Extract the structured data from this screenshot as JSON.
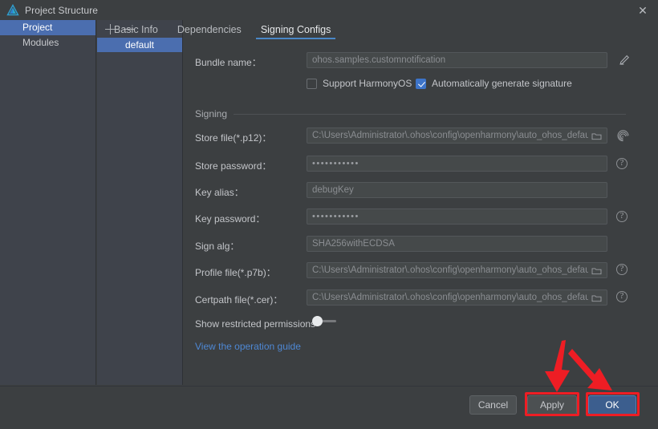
{
  "window": {
    "title": "Project Structure",
    "app_icon": "deveco-logo-icon",
    "close_label": "✕"
  },
  "sidebar": {
    "items": [
      {
        "label": "Project",
        "selected": true
      },
      {
        "label": "Modules",
        "selected": false
      }
    ]
  },
  "config_list": {
    "add_label": "+",
    "remove_label": "−",
    "items": [
      {
        "label": "default",
        "selected": true
      }
    ]
  },
  "tabs": [
    {
      "label": "Basic Info",
      "active": false
    },
    {
      "label": "Dependencies",
      "active": false
    },
    {
      "label": "Signing Configs",
      "active": true
    }
  ],
  "form": {
    "bundle_name": {
      "label": "Bundle name：",
      "value": "ohos.samples.customnotification",
      "edit_icon": "pencil-icon"
    },
    "support_harmonyos": {
      "label": "Support HarmonyOS",
      "checked": false
    },
    "auto_generate_signature": {
      "label": "Automatically generate signature",
      "checked": true
    },
    "section_signing": "Signing",
    "store_file": {
      "label": "Store file(*.p12)：",
      "value": "C:\\Users\\Administrator\\.ohos\\config\\openharmony\\auto_ohos_default",
      "browse_icon": "folder-icon",
      "side_icon": "fingerprint-icon"
    },
    "store_password": {
      "label": "Store password：",
      "value": "•••••••••••",
      "help_icon": "help-icon"
    },
    "key_alias": {
      "label": "Key alias：",
      "value": "debugKey"
    },
    "key_password": {
      "label": "Key password：",
      "value": "•••••••••••",
      "help_icon": "help-icon"
    },
    "sign_alg": {
      "label": "Sign alg：",
      "value": "SHA256withECDSA"
    },
    "profile_file": {
      "label": "Profile file(*.p7b)：",
      "value": "C:\\Users\\Administrator\\.ohos\\config\\openharmony\\auto_ohos_default",
      "browse_icon": "folder-icon",
      "help_icon": "help-icon"
    },
    "certpath_file": {
      "label": "Certpath file(*.cer)：",
      "value": "C:\\Users\\Administrator\\.ohos\\config\\openharmony\\auto_ohos_default",
      "browse_icon": "folder-icon",
      "help_icon": "help-icon"
    },
    "show_restricted_permissions": {
      "label": "Show restricted permissions",
      "enabled": false
    },
    "operation_guide_link": "View the operation guide"
  },
  "footer": {
    "cancel_label": "Cancel",
    "apply_label": "Apply",
    "ok_label": "OK"
  },
  "annotations": {
    "highlight_color": "#ee1d24",
    "highlighted_buttons": [
      "Apply",
      "OK"
    ],
    "arrow_count": 2
  },
  "colors": {
    "accent_blue": "#4b6eaf",
    "tab_underline": "#4a88c7",
    "link_blue": "#4e88d4",
    "checkbox_checked": "#3d74c9",
    "annotation_red": "#ee1d24",
    "window_bg": "#3c3f41",
    "panel_bg": "#3f434b"
  }
}
